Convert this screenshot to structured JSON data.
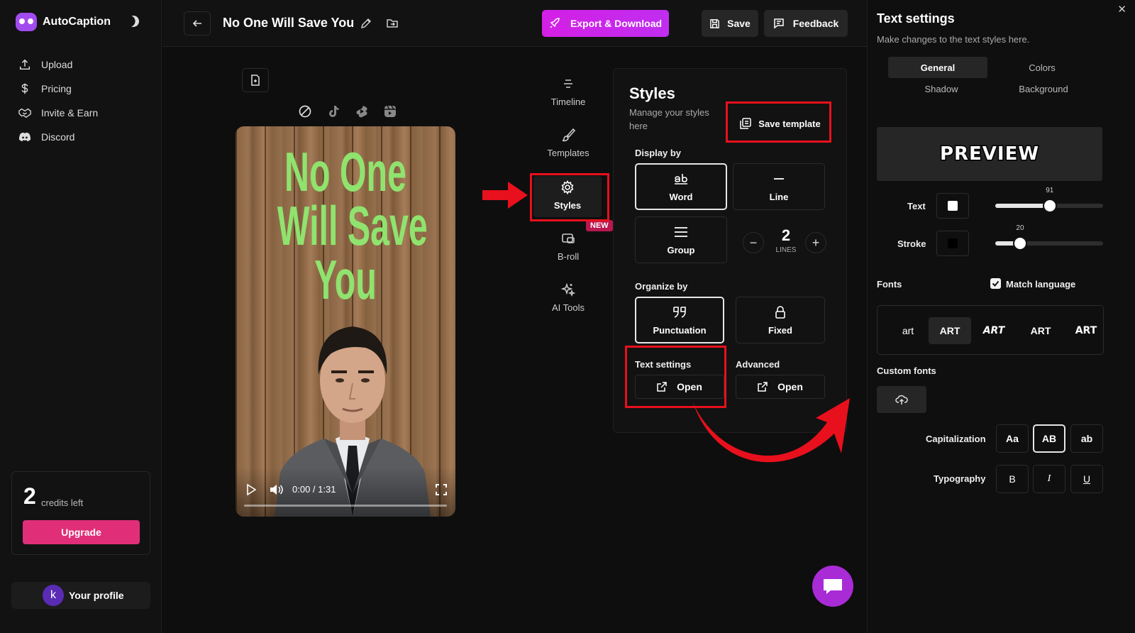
{
  "sidebar": {
    "app_name": "AutoCaption",
    "nav": [
      {
        "label": "Upload",
        "icon": "upload-icon"
      },
      {
        "label": "Pricing",
        "icon": "dollar-icon"
      },
      {
        "label": "Invite & Earn",
        "icon": "handshake-icon"
      },
      {
        "label": "Discord",
        "icon": "discord-icon"
      }
    ],
    "credits_count": "2",
    "credits_label": "credits left",
    "upgrade_label": "Upgrade",
    "profile_initial": "k",
    "profile_label": "Your profile"
  },
  "topbar": {
    "project_title": "No One Will Save You",
    "export_label": "Export & Download",
    "save_label": "Save",
    "feedback_label": "Feedback"
  },
  "video": {
    "caption_lines": [
      "No One",
      "Will Save",
      "You"
    ],
    "caption_color": "#8fe36e",
    "time": "0:00 / 1:31"
  },
  "tools": [
    {
      "label": "Timeline",
      "icon": "timeline-icon"
    },
    {
      "label": "Templates",
      "icon": "brush-icon"
    },
    {
      "label": "Styles",
      "icon": "gear-icon"
    },
    {
      "label": "B-roll",
      "icon": "broll-icon"
    },
    {
      "label": "AI Tools",
      "icon": "sparkle-icon"
    }
  ],
  "new_badge": "NEW",
  "styles_panel": {
    "title": "Styles",
    "subtitle": "Manage your styles here",
    "save_template_label": "Save template",
    "display_by_label": "Display by",
    "display_options": [
      "Word",
      "Line",
      "Group"
    ],
    "lines_value": "2",
    "lines_label": "LINES",
    "organize_by_label": "Organize by",
    "organize_options": [
      "Punctuation",
      "Fixed"
    ],
    "text_settings_label": "Text settings",
    "advanced_label": "Advanced",
    "open_label": "Open"
  },
  "text_settings": {
    "title": "Text settings",
    "subtitle": "Make changes to the text styles here.",
    "tabs": [
      "General",
      "Colors",
      "Shadow",
      "Background"
    ],
    "preview_text": "PREVIEW",
    "text_label": "Text",
    "text_size": "91",
    "text_fraction": 0.505,
    "text_color": "#ffffff",
    "stroke_label": "Stroke",
    "stroke_size": "20",
    "stroke_fraction": 0.23,
    "stroke_color": "#000000",
    "fonts_label": "Fonts",
    "match_language_label": "Match language",
    "font_options": [
      "art",
      "ART",
      "ART",
      "ART",
      "ART"
    ],
    "custom_fonts_label": "Custom fonts",
    "capitalization_label": "Capitalization",
    "cap_options": [
      "Aa",
      "AB",
      "ab"
    ],
    "typography_label": "Typography",
    "typo_options": [
      "B",
      "I",
      "U"
    ]
  },
  "colors": {
    "accent": "#c02ef0",
    "upgrade": "#e02e79",
    "annotation_red": "#e8101c"
  }
}
